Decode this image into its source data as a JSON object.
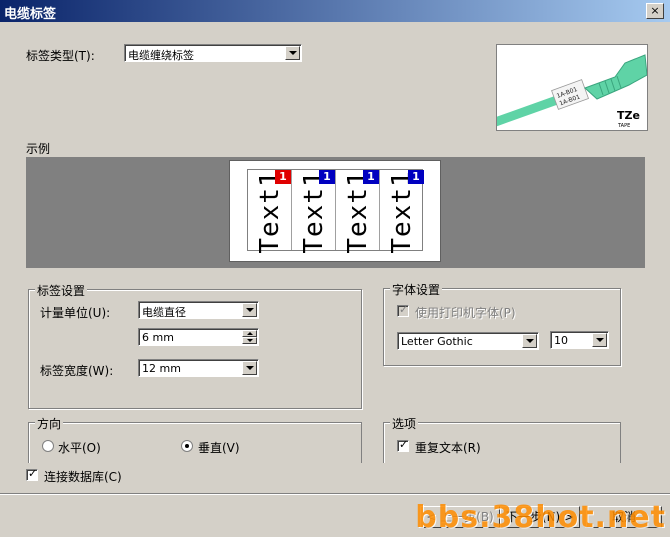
{
  "window": {
    "title": "电缆标签",
    "close_label": "×"
  },
  "label_type": {
    "label": "标签类型(T):",
    "value": "电缆缠绕标签"
  },
  "example": {
    "label": "示例",
    "cells": [
      {
        "text": "Text1",
        "badge": "1",
        "badge_color": "#e00000"
      },
      {
        "text": "Text1",
        "badge": "1",
        "badge_color": "#0000c0"
      },
      {
        "text": "Text1",
        "badge": "1",
        "badge_color": "#0000c0"
      },
      {
        "text": "Text1",
        "badge": "1",
        "badge_color": "#0000c0"
      }
    ]
  },
  "thumbnail": {
    "tape_logo": "TZe",
    "tape_sub": "TAPE",
    "wrap_text": "1A-B01"
  },
  "label_settings": {
    "title": "标签设置",
    "unit_label": "计量单位(U):",
    "unit_value": "电缆直径",
    "diameter_value": "6 mm",
    "width_label": "标签宽度(W):",
    "width_value": "12 mm"
  },
  "font_settings": {
    "title": "字体设置",
    "use_printer_font_label": "使用打印机字体(P)",
    "font_value": "Letter Gothic",
    "size_value": "10"
  },
  "direction": {
    "title": "方向",
    "horizontal_label": "水平(O)",
    "vertical_label": "垂直(V)"
  },
  "options": {
    "title": "选项",
    "repeat_text_label": "重复文本(R)"
  },
  "connect_db_label": "连接数据库(C)",
  "buttons": {
    "back": "< 上一步(B)",
    "next": "下一步(N) >",
    "cancel": "取消"
  },
  "watermark": "bbs.38hot.net",
  "colors": {
    "title_bar": "#0a246a",
    "preview_bg": "#808080",
    "cable": "#5fd3a6"
  }
}
